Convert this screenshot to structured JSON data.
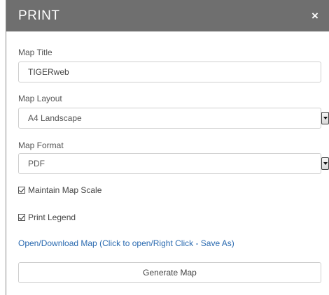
{
  "dialog": {
    "title": "PRINT",
    "close_symbol": "×",
    "map_title": {
      "label": "Map Title",
      "value": "TIGERweb"
    },
    "map_layout": {
      "label": "Map Layout",
      "selected": "A4 Landscape"
    },
    "map_format": {
      "label": "Map Format",
      "selected": "PDF"
    },
    "maintain_scale": {
      "label": "Maintain Map Scale",
      "checked": true
    },
    "print_legend": {
      "label": "Print Legend",
      "checked": true
    },
    "download_link": "Open/Download Map (Click to open/Right Click - Save As)",
    "generate_button": "Generate Map"
  },
  "colors": {
    "titlebar": "#6f6f6f",
    "link": "#2a6ab0"
  },
  "icons": [
    "close-icon",
    "dropdown-arrow-icon",
    "checkbox-checked-icon"
  ]
}
